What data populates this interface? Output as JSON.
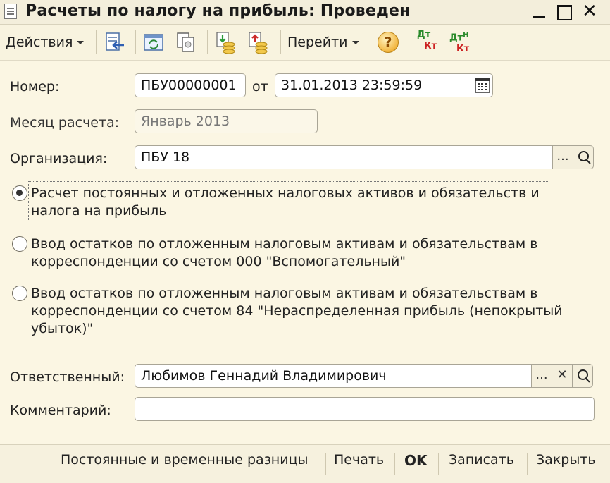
{
  "window": {
    "title": "Расчеты по налогу на прибыль: Проведен",
    "close_glyph": "✕"
  },
  "toolbar": {
    "actions_label": "Действия",
    "goto_label": "Перейти",
    "help_glyph": "?",
    "dtkt1": {
      "dt": "Дт",
      "kt": "Кт"
    },
    "dtkt2": {
      "dt": "Дт",
      "sup": "Н",
      "kt": "Кт"
    }
  },
  "form": {
    "number_label": "Номер:",
    "number_value": "ПБУ00000001",
    "from_label": "от",
    "date_value": "31.01.2013 23:59:59",
    "month_label": "Месяц расчета:",
    "month_value": "Январь 2013",
    "org_label": "Организация:",
    "org_value": "ПБУ 18",
    "ellipsis": "...",
    "radio_options": [
      {
        "line1": "Расчет постоянных и отложенных налоговых активов и обязательств и",
        "line2": "налога на прибыль",
        "line3": "",
        "checked": true
      },
      {
        "line1": "Ввод остатков по отложенным налоговым активам и обязательствам в",
        "line2": "корреспонденции со счетом 000 \"Вспомогательный\"",
        "line3": "",
        "checked": false
      },
      {
        "line1": "Ввод остатков по отложенным налоговым активам и обязательствам в",
        "line2": "корреспонденции со счетом 84 \"Нераспределенная прибыль (непокрытый",
        "line3": "убыток)\"",
        "checked": false
      }
    ],
    "responsible_label": "Ответственный:",
    "responsible_value": "Любимов Геннадий Владимирович",
    "clear_glyph": "✕",
    "comment_label": "Комментарий:",
    "comment_value": ""
  },
  "bottom": {
    "diffs_label": "Постоянные и временные разницы",
    "print_label": "Печать",
    "ok_label": "OK",
    "save_label": "Записать",
    "close_label": "Закрыть"
  }
}
